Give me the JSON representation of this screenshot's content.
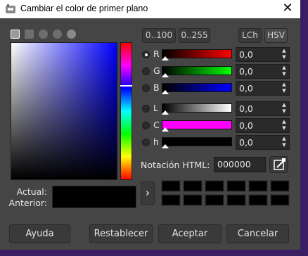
{
  "window": {
    "title": "Cambiar el color de primer plano",
    "close_glyph": "✕"
  },
  "selector_icons": [
    "gimp-icon",
    "square-icon",
    "watercolor-icon",
    "wheel-icon",
    "palette-icon"
  ],
  "range_buttons": {
    "r100": "0..100",
    "r255": "0..255"
  },
  "model_buttons": {
    "lch": "LCh",
    "hsv": "HSV"
  },
  "channels": [
    {
      "key": "R",
      "label": "R",
      "value": "0,0",
      "selected": true
    },
    {
      "key": "G",
      "label": "G",
      "value": "0,0",
      "selected": false
    },
    {
      "key": "B",
      "label": "B",
      "value": "0,0",
      "selected": false
    },
    {
      "key": "L",
      "label": "L",
      "value": "0,0",
      "selected": false
    },
    {
      "key": "C",
      "label": "C",
      "value": "0,0",
      "selected": false
    },
    {
      "key": "h",
      "label": "h",
      "value": "0,0",
      "selected": false
    }
  ],
  "html_notation": {
    "label": "Notación HTML:",
    "value": "000000"
  },
  "swatch": {
    "current_label": "Actual:",
    "previous_label": "Anterior:",
    "color": "#000000"
  },
  "history_arrow": "›",
  "history_colors": [
    "#000000",
    "#000000",
    "#000000",
    "#000000",
    "#000000",
    "#000000",
    "#000000",
    "#000000",
    "#000000",
    "#000000",
    "#000000",
    "#000000"
  ],
  "footer": {
    "help": "Ayuda",
    "reset": "Restablecer",
    "ok": "Aceptar",
    "cancel": "Cancelar"
  },
  "colors": {
    "accent_purple": "#3b1d63",
    "panel": "#454545"
  }
}
